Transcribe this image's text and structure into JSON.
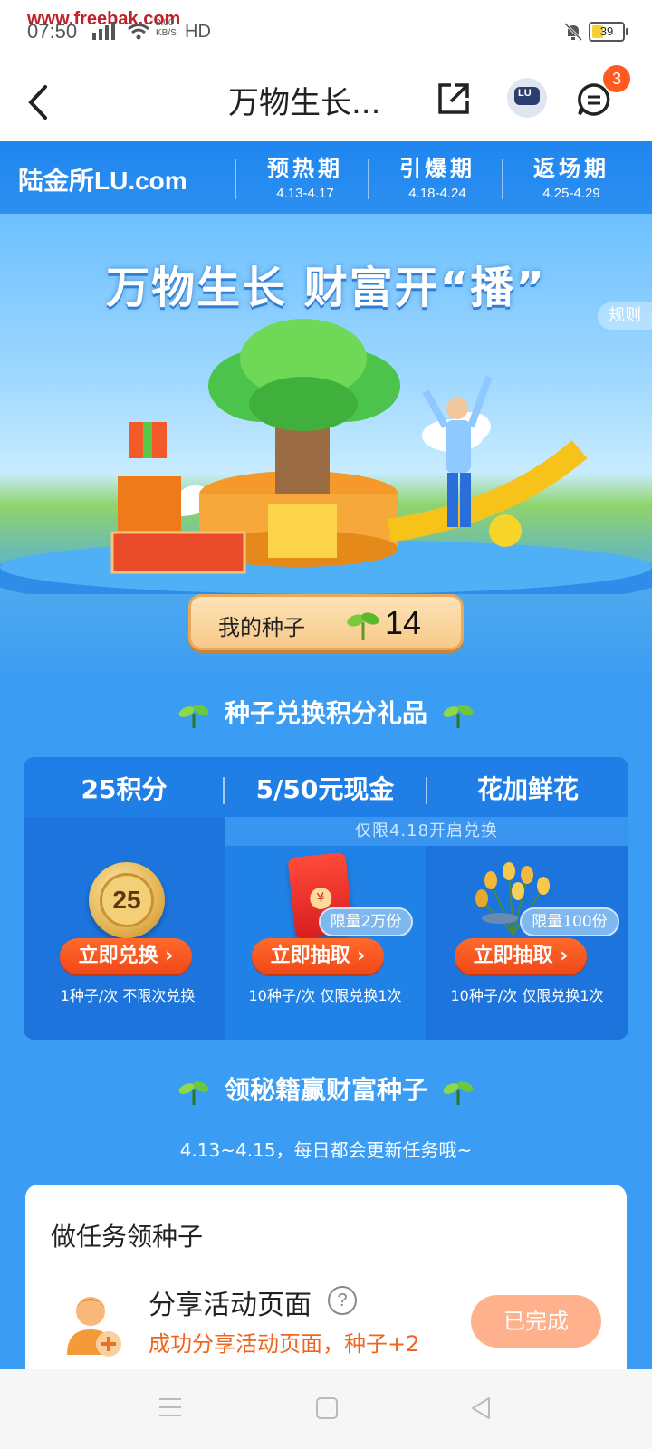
{
  "status_bar": {
    "time": "07:50",
    "watermark": "www.freebak.com",
    "network_speed": "2.00\nKB/S",
    "hd_label": "HD",
    "battery_level": 39,
    "battery_text": "39"
  },
  "nav": {
    "title": "万物生长...",
    "message_badge": "3",
    "icons": [
      "back-icon",
      "share-icon",
      "robot-icon",
      "message-icon"
    ]
  },
  "phase_bar": {
    "logo": "陆金所LU.com",
    "phases": [
      {
        "name": "预热期",
        "date": "4.13-4.17"
      },
      {
        "name": "引爆期",
        "date": "4.18-4.24"
      },
      {
        "name": "返场期",
        "date": "4.25-4.29"
      }
    ]
  },
  "hero": {
    "headline": "万物生长  财富开“播”",
    "rules_label": "规则",
    "my_seeds_label": "我的种子",
    "my_seeds_count": "14"
  },
  "exchange_section": {
    "title": "种子兑换积分礼品",
    "notice": "仅限4.18开启兑换",
    "gifts": [
      {
        "tab": "25积分",
        "image_text": "25",
        "button": "立即兑换",
        "note": "1种子/次 不限次兑换",
        "limit": ""
      },
      {
        "tab": "5/50元现金",
        "image_text": "¥",
        "button": "立即抽取",
        "note": "10种子/次 仅限兑换1次",
        "limit": "限量2万份"
      },
      {
        "tab": "花加鲜花",
        "image_text": "",
        "button": "立即抽取",
        "note": "10种子/次 仅限兑换1次",
        "limit": "限量100份"
      }
    ]
  },
  "secret_section": {
    "title": "领秘籍赢财富种子",
    "subtitle": "4.13~4.15，每日都会更新任务哦~"
  },
  "task_card": {
    "heading": "做任务领种子",
    "tasks": [
      {
        "name": "分享活动页面",
        "help": "?",
        "desc": "成功分享活动页面，种子+2",
        "status": "已完成"
      }
    ]
  },
  "colors": {
    "brand_blue": "#3a9cf2",
    "orange_button": "#f0481a",
    "task_orange": "#f0651c",
    "done_button": "#ffb08c"
  }
}
